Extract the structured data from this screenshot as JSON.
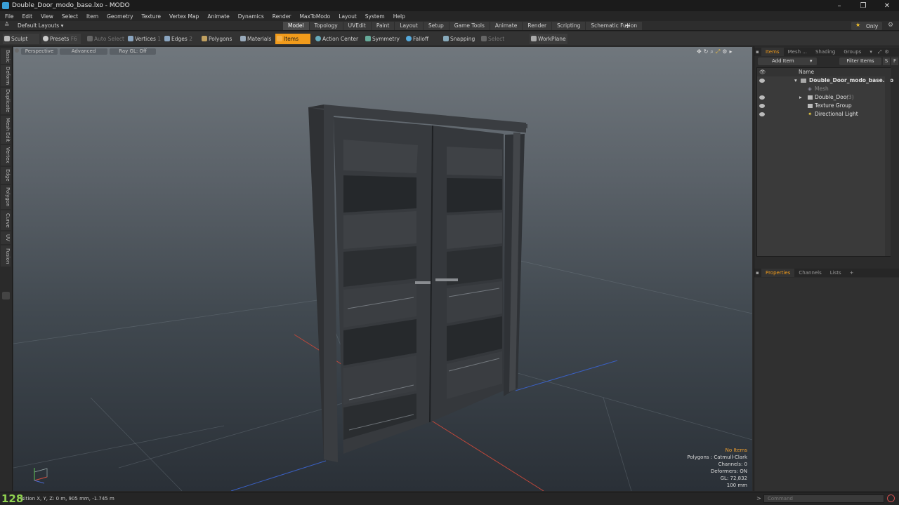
{
  "window": {
    "title": "Double_Door_modo_base.lxo - MODO",
    "controls": [
      "–",
      "❐",
      "✕"
    ]
  },
  "menu": [
    "File",
    "Edit",
    "View",
    "Select",
    "Item",
    "Geometry",
    "Texture",
    "Vertex Map",
    "Animate",
    "Dynamics",
    "Render",
    "MaxToModo",
    "Layout",
    "System",
    "Help"
  ],
  "layout_bar": {
    "layout_name": "Default Layouts ▾",
    "tabs": [
      "Model",
      "Topology",
      "UVEdit",
      "Paint",
      "Layout",
      "Setup",
      "Game Tools",
      "Animate",
      "Render",
      "Scripting",
      "Schematic Fusion"
    ],
    "active_tab": "Model",
    "add_tab": "+",
    "only_label": "Only"
  },
  "toolbar": {
    "sculpt": "Sculpt",
    "presets": "Presets",
    "presets_key": "F6",
    "auto_select": "Auto Select",
    "vertices": "Vertices",
    "vertices_key": "1",
    "edges": "Edges",
    "edges_key": "2",
    "polygons": "Polygons",
    "materials": "Materials",
    "items": "Items",
    "action_center": "Action Center",
    "symmetry": "Symmetry",
    "falloff": "Falloff",
    "snapping": "Snapping",
    "select_through": "Select Through",
    "workplane": "WorkPlane"
  },
  "left_tabs": [
    "Basic",
    "Deform",
    "Duplicate",
    "Mesh Edit",
    "Vertex",
    "Edge",
    "Polygon",
    "Curve",
    "UV",
    "Fusion"
  ],
  "viewport": {
    "perspective": "Perspective",
    "advanced": "Advanced",
    "raygl": "Ray GL: Off",
    "info": {
      "no_items": "No Items",
      "polygons": "Polygons : Catmull-Clark",
      "channels": "Channels: 0",
      "deformers": "Deformers: ON",
      "gl": "GL: 72,832",
      "unit": "100 mm"
    }
  },
  "items_panel": {
    "tabs": [
      "Items",
      "Mesh ...",
      "Shading",
      "Groups"
    ],
    "active_tab": "Items",
    "add_item": "Add Item",
    "filter_items": "Filter Items",
    "s": "S",
    "f": "F",
    "name_header": "Name",
    "rows": [
      {
        "label": "Double_Door_modo_base.lxo",
        "note": ""
      },
      {
        "label": "Mesh",
        "note": ""
      },
      {
        "label": "Double_Door",
        "note": "(3)"
      },
      {
        "label": "Texture Group",
        "note": ""
      },
      {
        "label": "Directional Light",
        "note": ""
      }
    ]
  },
  "properties_panel": {
    "tabs": [
      "Properties",
      "Channels",
      "Lists"
    ],
    "active_tab": "Properties",
    "add_tab": "+"
  },
  "status": {
    "fps": "128",
    "position": "sition X, Y, Z:   0 m, 905 mm, -1.745 m",
    "command_placeholder": "Command"
  },
  "colors": {
    "accent": "#f19b1b",
    "fps_green": "#8fd14f"
  }
}
